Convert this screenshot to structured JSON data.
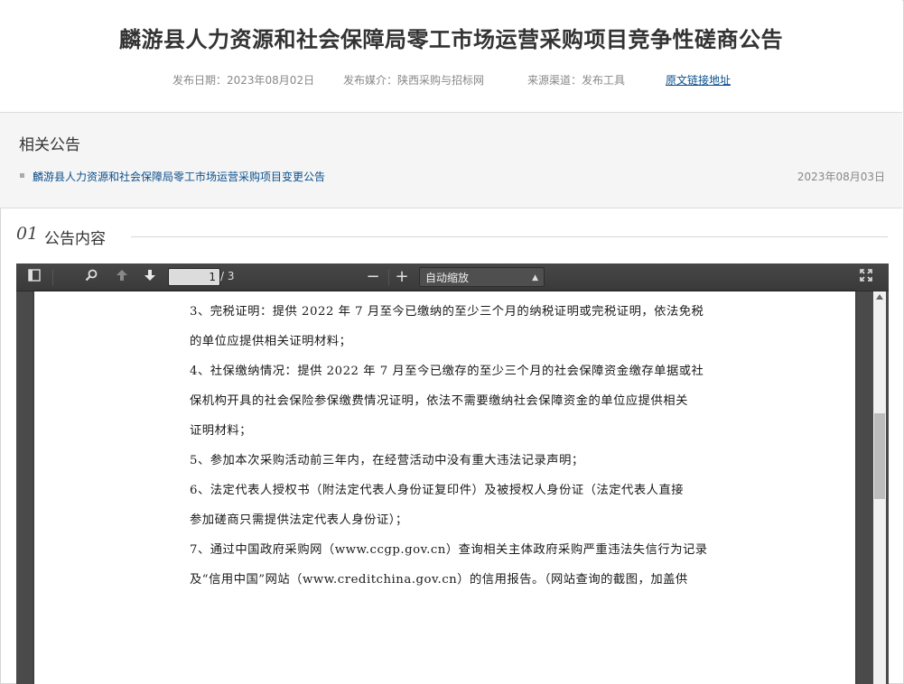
{
  "header": {
    "title": "麟游县人力资源和社会保障局零工市场运营采购项目竞争性磋商公告",
    "publish_date": "发布日期：2023年08月02日",
    "media": "发布媒介：陕西采购与招标网",
    "source": "来源渠道：发布工具",
    "origin_link": "原文链接地址"
  },
  "related": {
    "heading": "相关公告",
    "items": [
      {
        "title": "麟游县人力资源和社会保障局零工市场运营采购项目变更公告",
        "date": "2023年08月03日"
      }
    ]
  },
  "section": {
    "number": "01",
    "title": "公告内容"
  },
  "viewer": {
    "page_current": "1",
    "page_total": "/ 3",
    "zoom_value": "自动缩放",
    "icons": [
      "sidebar-toggle-icon",
      "search-icon",
      "prev-page-icon",
      "next-page-icon",
      "zoom-out-icon",
      "zoom-in-icon",
      "fullscreen-icon"
    ],
    "lines": [
      "3、完税证明：提供 2022 年 7 月至今已缴纳的至少三个月的纳税证明或完税证明，依法免税",
      "的单位应提供相关证明材料；",
      "4、社保缴纳情况：提供 2022 年 7 月至今已缴存的至少三个月的社会保障资金缴存单据或社",
      "保机构开具的社会保险参保缴费情况证明，依法不需要缴纳社会保障资金的单位应提供相关",
      "证明材料；",
      "5、参加本次采购活动前三年内，在经营活动中没有重大违法记录声明；",
      "6、法定代表人授权书（附法定代表人身份证复印件）及被授权人身份证（法定代表人直接",
      "参加磋商只需提供法定代表人身份证）；",
      "7、通过中国政府采购网（www.ccgp.gov.cn）查询相关主体政府采购严重违法失信行为记录",
      "及“信用中国”网站（www.creditchina.gov.cn）的信用报告。（网站查询的截图，加盖供"
    ]
  }
}
